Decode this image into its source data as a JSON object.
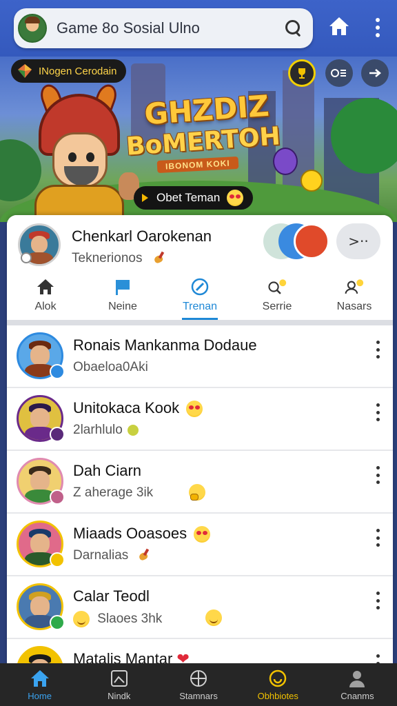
{
  "header": {
    "search_text": "Game 8o Sosial Ulno",
    "icons": [
      "avatar",
      "search-icon",
      "home-icon",
      "more-vertical-icon"
    ]
  },
  "banner": {
    "badge_label": "INogen Cerodain",
    "title_line1": "GHZDIZ",
    "title_line2": "BoMERTOH",
    "subtitle": "IBONOM KOKI",
    "add_friend_label": "Obet Teman"
  },
  "profile": {
    "name": "Chenkarl Oarokenan",
    "subtitle": "Teknerionos"
  },
  "tabs": [
    {
      "label": "Alok",
      "icon": "home-icon"
    },
    {
      "label": "Neine",
      "icon": "flag-icon"
    },
    {
      "label": "Trenan",
      "icon": "compass-icon",
      "active": true
    },
    {
      "label": "Serrie",
      "icon": "search-emoji-icon"
    },
    {
      "label": "Nasars",
      "icon": "user-emoji-icon"
    }
  ],
  "friends": [
    {
      "name": "Ronais Mankanma Dodaue",
      "sub": "Obaeloa0Aki",
      "status_color": "#2d8ae0"
    },
    {
      "name": "Unitokaca Kook",
      "sub": "2larhlulo",
      "status_color": "#5a2a7a"
    },
    {
      "name": "Dah Ciarn",
      "sub": "Z aherage 3ik",
      "status_color": "#c0608a"
    },
    {
      "name": "Miaads Ooasoes",
      "sub": "Darnalias",
      "status_color": "#f2c200"
    },
    {
      "name": "Calar Teodl",
      "sub": "Slaoes 3hk",
      "status_color": "#2faa4a"
    },
    {
      "name": "Matalis Mantar",
      "sub": "",
      "status_color": "#f2c200"
    }
  ],
  "bottom_nav": [
    {
      "label": "Home",
      "icon": "home-icon",
      "active": true
    },
    {
      "label": "Nindk",
      "icon": "image-icon"
    },
    {
      "label": "Stamnars",
      "icon": "globe-icon"
    },
    {
      "label": "Obhbiotes",
      "icon": "smile-circle-icon",
      "highlight": true
    },
    {
      "label": "Cnanms",
      "icon": "user-icon"
    }
  ],
  "colors": {
    "topbar": "#3459bd",
    "accent": "#1e88d6",
    "nav_bg": "#262626",
    "gold": "#f2c200"
  }
}
